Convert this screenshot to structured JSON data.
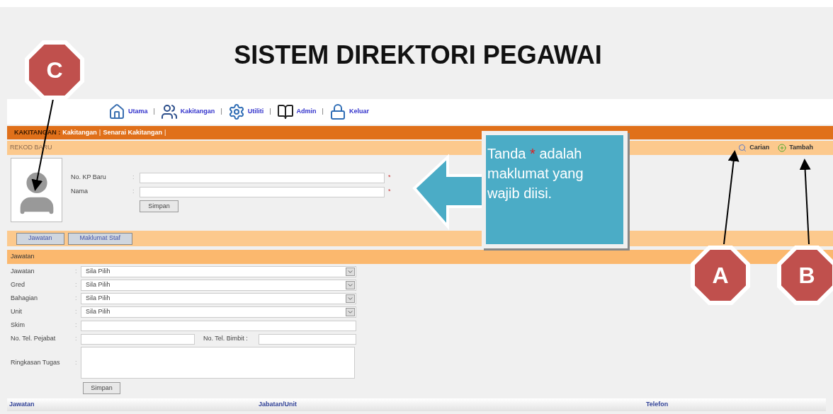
{
  "title": "SISTEM DIREKTORI PEGAWAI",
  "nav": [
    {
      "kind": "home",
      "label": "Utama"
    },
    {
      "kind": "staff",
      "label": "Kakitangan"
    },
    {
      "kind": "utility",
      "label": "Utiliti"
    },
    {
      "kind": "admin",
      "label": "Admin"
    },
    {
      "kind": "logout",
      "label": "Keluar"
    }
  ],
  "nav_separators": [
    "|",
    "|",
    "|",
    "|"
  ],
  "breadcrumb": {
    "section": "KAKITANGAN :",
    "links": [
      "Kakitangan",
      "Senarai Kakitangan"
    ],
    "separators": [
      "|",
      "|"
    ]
  },
  "record_bar": {
    "title": "REKOD BARU",
    "actions": [
      {
        "kind": "search",
        "label": "Carian"
      },
      {
        "kind": "add",
        "label": "Tambah"
      }
    ]
  },
  "identity_form": {
    "fields": [
      {
        "label": "No. KP Baru",
        "separator": ":",
        "required_mark": "*"
      },
      {
        "label": "Nama",
        "separator": ":",
        "required_mark": "*"
      }
    ],
    "button": "Simpan"
  },
  "tabs": [
    "Jawatan",
    "Maklumat Staf"
  ],
  "section": {
    "title": "Jawatan",
    "rows": [
      {
        "kind": "select",
        "label": "Jawatan",
        "separator": ":",
        "value": "Sila Pilih"
      },
      {
        "kind": "select",
        "label": "Gred",
        "separator": ":",
        "value": "Sila Pilih"
      },
      {
        "kind": "select",
        "label": "Bahagian",
        "separator": ":",
        "value": "Sila Pilih"
      },
      {
        "kind": "select",
        "label": "Unit",
        "separator": ":",
        "value": "Sila Pilih"
      },
      {
        "kind": "text",
        "label": "Skim",
        "separator": ":"
      },
      {
        "kind": "pair",
        "label": "No. Tel. Pejabat",
        "separator": ":",
        "second_label": "No. Tel. Bimbit :"
      },
      {
        "kind": "textarea",
        "label": "Ringkasan Tugas",
        "separator": ":"
      }
    ],
    "button": "Simpan"
  },
  "table": {
    "columns": [
      "Jawatan",
      "Jabatan/Unit",
      "Telefon"
    ]
  },
  "callout": {
    "before": "Tanda",
    "mark": "*",
    "after": "adalah maklumat yang wajib diisi."
  },
  "badges": [
    {
      "label": "A"
    },
    {
      "label": "B"
    },
    {
      "label": "C"
    }
  ]
}
